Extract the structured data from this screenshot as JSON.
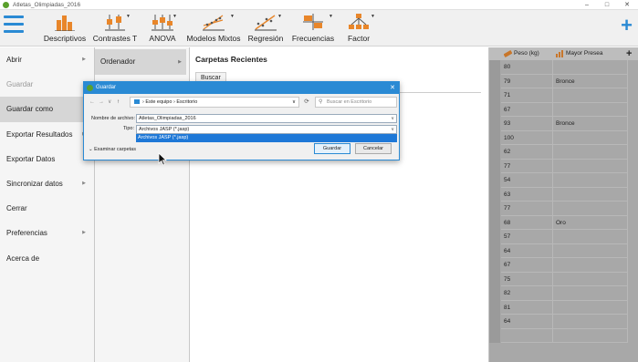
{
  "window": {
    "title": "Atletas_Olimpiadas_2016",
    "minimize": "–",
    "maximize": "□",
    "close": "✕"
  },
  "ribbon": {
    "items": [
      {
        "label": "Descriptivos",
        "icon": "bar-chart-icon"
      },
      {
        "label": "Contrastes T",
        "icon": "t-test-icon"
      },
      {
        "label": "ANOVA",
        "icon": "anova-icon"
      },
      {
        "label": "Modelos Mixtos",
        "icon": "mixed-models-icon"
      },
      {
        "label": "Regresión",
        "icon": "regression-icon"
      },
      {
        "label": "Frecuencias",
        "icon": "frequencies-icon"
      },
      {
        "label": "Factor",
        "icon": "factor-icon"
      }
    ],
    "add_label": "+"
  },
  "menu": {
    "items": [
      {
        "label": "Abrir",
        "arrow": "▶",
        "disabled": false,
        "selected": false
      },
      {
        "label": "Guardar",
        "arrow": "",
        "disabled": true,
        "selected": false
      },
      {
        "label": "Guardar como",
        "arrow": "",
        "disabled": false,
        "selected": true
      },
      {
        "label": "Exportar Resultados",
        "arrow": "▶",
        "disabled": false,
        "selected": false
      },
      {
        "label": "Exportar Datos",
        "arrow": "",
        "disabled": false,
        "selected": false
      },
      {
        "label": "Sincronizar datos",
        "arrow": "▶",
        "disabled": false,
        "selected": false
      },
      {
        "label": "Cerrar",
        "arrow": "",
        "disabled": false,
        "selected": false
      },
      {
        "label": "Preferencias",
        "arrow": "▶",
        "disabled": false,
        "selected": false
      },
      {
        "label": "Acerca de",
        "arrow": "",
        "disabled": false,
        "selected": false
      }
    ]
  },
  "submenu": {
    "label": "Ordenador",
    "arrow": "▶"
  },
  "content": {
    "title": "Carpetas Recientes",
    "browse_label": "Buscar"
  },
  "grid": {
    "headers": [
      "Peso (kg)",
      "Mayor Presea"
    ],
    "add_column": "+",
    "rows": [
      [
        "80",
        ""
      ],
      [
        "79",
        "Bronce"
      ],
      [
        "71",
        ""
      ],
      [
        "67",
        ""
      ],
      [
        "93",
        "Bronce"
      ],
      [
        "100",
        ""
      ],
      [
        "62",
        ""
      ],
      [
        "77",
        ""
      ],
      [
        "54",
        ""
      ],
      [
        "63",
        ""
      ],
      [
        "77",
        ""
      ],
      [
        "68",
        "Oro"
      ],
      [
        "57",
        ""
      ],
      [
        "64",
        ""
      ],
      [
        "67",
        ""
      ],
      [
        "75",
        ""
      ],
      [
        "82",
        ""
      ],
      [
        "81",
        ""
      ],
      [
        "64",
        ""
      ],
      [
        "",
        ""
      ]
    ]
  },
  "dialog": {
    "title": "Guardar",
    "close": "✕",
    "nav": {
      "back": "←",
      "forward": "→",
      "recent": "∨",
      "up": "↑"
    },
    "path": [
      "Este equipo",
      "Escritorio"
    ],
    "path_sep": "›",
    "path_dropdown": "∨",
    "refresh": "⟳",
    "search_placeholder": "Buscar en Escritorio",
    "filename_label": "Nombre de archivo:",
    "filename_value": "Atletas_Olimpiadas_2016",
    "type_label": "Tipo:",
    "type_value": "Archivos JASP (*.jasp)",
    "type_option_highlighted": "Archivos JASP (*.jasp)",
    "browse_folders": "Examinar carpetas",
    "save_button": "Guardar",
    "cancel_button": "Cancelar"
  },
  "colors": {
    "accent": "#2a8ad4",
    "logo": "#5aa02c",
    "highlight": "#1e78d7",
    "grid_bg": "#a8a8a8"
  }
}
